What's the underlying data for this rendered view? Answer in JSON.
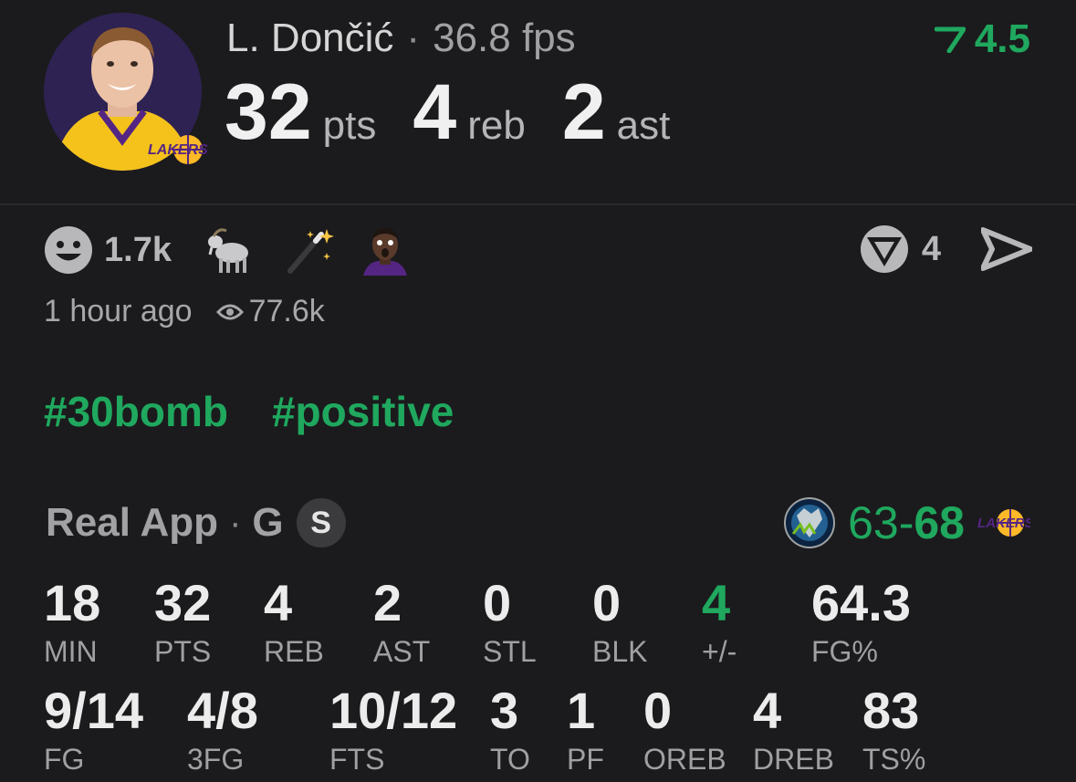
{
  "player": {
    "name": "L. Dončić",
    "separator": "·",
    "fps": "36.8 fps",
    "pts_value": "32",
    "pts_unit": "pts",
    "reb_value": "4",
    "reb_unit": "reb",
    "ast_value": "2",
    "ast_unit": "ast",
    "rating": "4.5"
  },
  "reactions": {
    "count": "1.7k",
    "emojis": [
      "smiley-icon",
      "goat-icon",
      "magic-wand-icon",
      "shocked-player-sticker"
    ],
    "reply_count": "4"
  },
  "meta": {
    "time_ago": "1 hour ago",
    "views": "77.6k"
  },
  "tags": [
    "#30bomb",
    "#positive"
  ],
  "source": {
    "name": "Real App",
    "separator": "·",
    "position": "G",
    "badge": "S"
  },
  "game": {
    "away_score": "63",
    "dash": "-",
    "home_score": "68"
  },
  "stats_row1": [
    {
      "value": "18",
      "label": "MIN"
    },
    {
      "value": "32",
      "label": "PTS"
    },
    {
      "value": "4",
      "label": "REB"
    },
    {
      "value": "2",
      "label": "AST"
    },
    {
      "value": "0",
      "label": "STL"
    },
    {
      "value": "0",
      "label": "BLK"
    },
    {
      "value": "4",
      "label": "+/-"
    },
    {
      "value": "64.3",
      "label": "FG%"
    }
  ],
  "stats_row2": [
    {
      "value": "9/14",
      "label": "FG"
    },
    {
      "value": "4/8",
      "label": "3FG"
    },
    {
      "value": "10/12",
      "label": "FTS"
    },
    {
      "value": "3",
      "label": "TO"
    },
    {
      "value": "1",
      "label": "PF"
    },
    {
      "value": "0",
      "label": "OREB"
    },
    {
      "value": "4",
      "label": "DREB"
    },
    {
      "value": "83",
      "label": "TS%"
    }
  ],
  "colors": {
    "background": "#1b1b1d",
    "accent_green": "#1fa85e",
    "lakers_purple": "#552583",
    "lakers_gold": "#fdb927"
  }
}
